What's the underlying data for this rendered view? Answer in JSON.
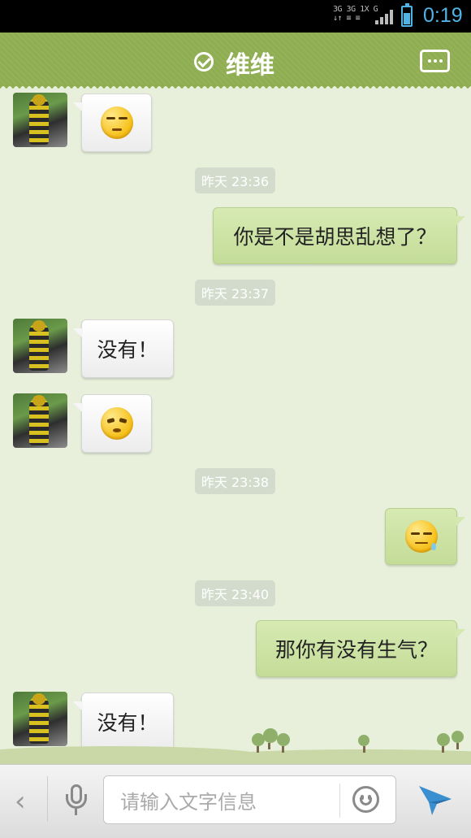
{
  "status_bar": {
    "network_line1": "3G 3G 1X G",
    "network_line2": "↓↑ ≡ ≡",
    "time": "0:19",
    "accent_color": "#4fb3e6"
  },
  "header": {
    "title": "维维",
    "status_icon": "verified-check-icon",
    "menu_icon": "more-dots-icon",
    "background_color": "#8fae52"
  },
  "messages": {
    "m1": {
      "type": "emoji",
      "emoji": "smirk-face"
    },
    "ts1": "昨天 23:36",
    "m2": "你是不是胡思乱想了？",
    "ts2": "昨天 23:37",
    "m3": "没有！",
    "m4": {
      "type": "emoji",
      "emoji": "sly-face"
    },
    "ts3": "昨天 23:38",
    "m5": {
      "type": "emoji",
      "emoji": "sweat-face"
    },
    "ts4": "昨天 23:40",
    "m6": "那你有没有生气？",
    "m7": "没有！"
  },
  "input_bar": {
    "placeholder": "请输入文字信息",
    "back_icon": "chevron-left-icon",
    "voice_icon": "microphone-icon",
    "emoji_icon": "smiley-icon",
    "send_icon": "send-arrow-icon"
  },
  "colors": {
    "incoming_bubble": "#f4f4f4",
    "outgoing_bubble": "#cde3a5",
    "chat_background": "#e8f0dc",
    "timestamp_pill": "#d3dccc"
  }
}
